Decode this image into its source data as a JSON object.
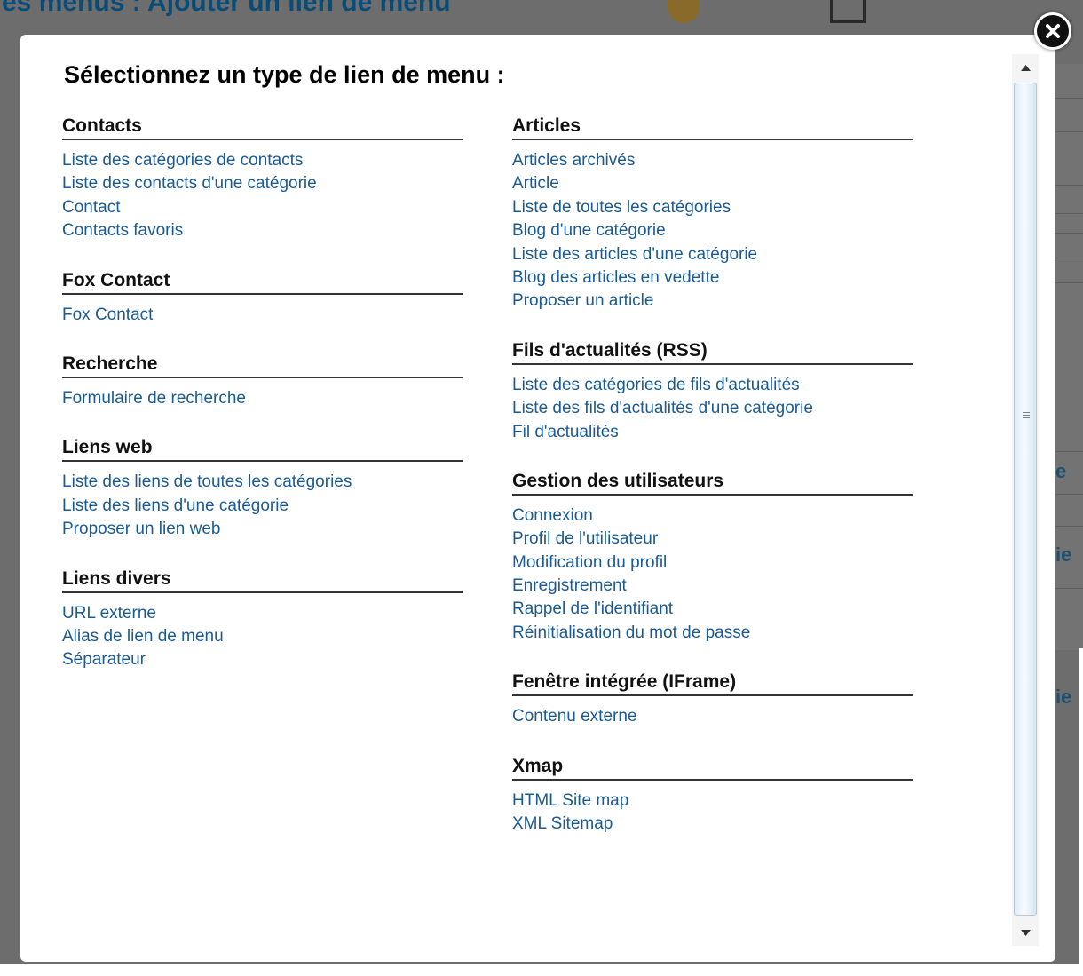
{
  "background": {
    "page_title": "es menus : Ajouter un lien de menu",
    "side_fragments": [
      "e",
      "ie",
      "ie"
    ]
  },
  "modal": {
    "title": "Sélectionnez un type de lien de menu :",
    "close_icon": "close-x-icon"
  },
  "left_column": [
    {
      "heading": "Contacts",
      "links": [
        "Liste des catégories de contacts",
        "Liste des contacts d'une catégorie",
        "Contact",
        "Contacts favoris"
      ]
    },
    {
      "heading": "Fox Contact",
      "links": [
        "Fox Contact"
      ]
    },
    {
      "heading": "Recherche",
      "links": [
        "Formulaire de recherche"
      ]
    },
    {
      "heading": "Liens web",
      "links": [
        "Liste des liens de toutes les catégories",
        "Liste des liens d'une catégorie",
        "Proposer un lien web"
      ]
    },
    {
      "heading": "Liens divers",
      "links": [
        "URL externe",
        "Alias de lien de menu",
        "Séparateur"
      ]
    }
  ],
  "right_column": [
    {
      "heading": "Articles",
      "links": [
        "Articles archivés",
        "Article",
        "Liste de toutes les catégories",
        "Blog d'une catégorie",
        "Liste des articles d'une catégorie",
        "Blog des articles en vedette",
        "Proposer un article"
      ]
    },
    {
      "heading": "Fils d'actualités (RSS)",
      "links": [
        "Liste des catégories de fils d'actualités",
        "Liste des fils d'actualités d'une catégorie",
        "Fil d'actualités"
      ]
    },
    {
      "heading": "Gestion des utilisateurs",
      "links": [
        "Connexion",
        "Profil de l'utilisateur",
        "Modification du profil",
        "Enregistrement",
        "Rappel de l'identifiant",
        "Réinitialisation du mot de passe"
      ]
    },
    {
      "heading": "Fenêtre intégrée (IFrame)",
      "links": [
        "Contenu externe"
      ]
    },
    {
      "heading": "Xmap",
      "links": [
        "HTML Site map",
        "XML Sitemap"
      ]
    }
  ],
  "colors": {
    "link": "#1b5b94",
    "heading": "#111111",
    "overlay": "#6d6d6d"
  }
}
